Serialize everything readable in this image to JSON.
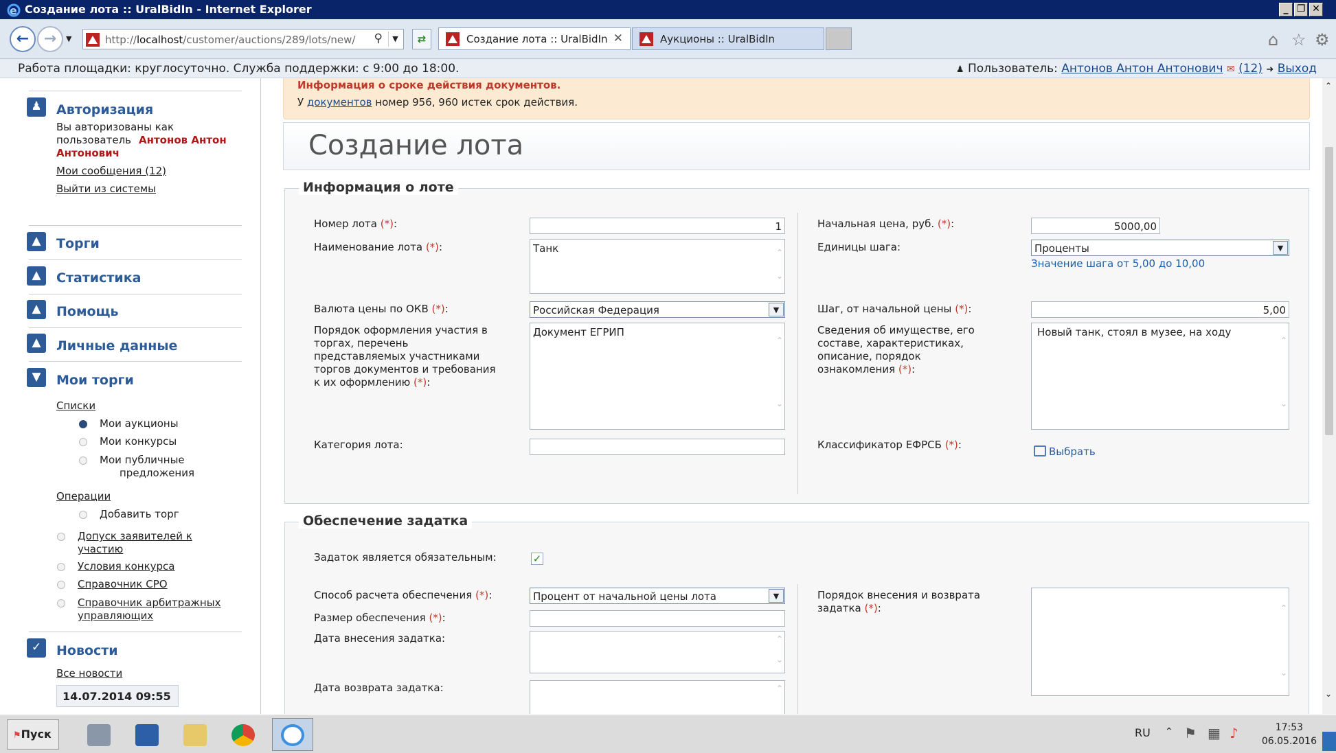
{
  "window": {
    "title": "Создание лота :: UralBidIn - Internet Explorer",
    "controls": [
      "_",
      "❐",
      "✕"
    ]
  },
  "browser": {
    "url_prefix": "http://",
    "url_host": "localhost",
    "url_path": "/customer/auctions/289/lots/new/",
    "tabs": [
      {
        "label": "Создание лота :: UralBidIn",
        "close": "✕"
      },
      {
        "label": "Аукционы :: UralBidIn"
      }
    ]
  },
  "infobar": {
    "left": "Работа площадки: круглосуточно. Служба поддержки: с 9:00 до 18:00.",
    "user_label": "Пользователь:",
    "user_name": "Антонов Антон Антонович",
    "messages": "(12)",
    "logout": "Выход"
  },
  "sidebar": {
    "auth": {
      "title": "Авторизация",
      "text1": "Вы авторизованы как",
      "text2": "пользователь",
      "user": "Антонов Антон",
      "user2": "Антонович",
      "messages": "Мои сообщения (12)",
      "logout": "Выйти из системы"
    },
    "sections": [
      "Торги",
      "Статистика",
      "Помощь",
      "Личные данные",
      "Мои торги"
    ],
    "lists": {
      "title": "Списки",
      "items": [
        "Мои аукционы",
        "Мои конкурсы",
        "Мои публичные",
        "предложения"
      ]
    },
    "operations": {
      "title": "Операции",
      "add": "Добавить торг",
      "links": [
        [
          "Допуск заявителей к",
          "участию"
        ],
        [
          "Условия конкурса"
        ],
        [
          "Справочник СРО"
        ],
        [
          "Справочник арбитражных",
          "управляющих"
        ]
      ]
    },
    "news": {
      "title": "Новости",
      "all": "Все новости",
      "date": "14.07.2014 09:55"
    }
  },
  "warning": {
    "title": "Информация о сроке действия документов.",
    "prefix": "У",
    "link": "документов",
    "suffix": "номер 956, 960 истек срок действия."
  },
  "page_title": "Создание лота",
  "lot_info": {
    "legend": "Информация о лоте",
    "lot_number": {
      "label": "Номер лота",
      "value": "1"
    },
    "lot_name": {
      "label": "Наименование лота",
      "value": "Танк"
    },
    "currency": {
      "label": "Валюта цены по ОКВ",
      "value": "Российская Федерация"
    },
    "order": {
      "label_lines": [
        "Порядок оформления участия в",
        "торгах, перечень",
        "представляемых участниками",
        "торгов документов и требования",
        "к их оформлению"
      ],
      "value": "Документ ЕГРИП"
    },
    "category": {
      "label": "Категория лота:",
      "value": ""
    },
    "start_price": {
      "label": "Начальная цена, руб.",
      "value": "5000,00"
    },
    "step_units": {
      "label": "Единицы шага:",
      "value": "Проценты",
      "hint": "Значение шага от 5,00 до 10,00"
    },
    "step": {
      "label": "Шаг, от начальной цены",
      "value": "5,00"
    },
    "property": {
      "label_lines": [
        "Сведения об имуществе, его",
        "составе, характеристиках,",
        "описание, порядок",
        "ознакомления"
      ],
      "value": "Новый танк, стоял в музее, на ходу"
    },
    "efrsb": {
      "label": "Классификатор ЕФРСБ",
      "button": "Выбрать"
    },
    "req_mark": "(*)"
  },
  "deposit": {
    "legend": "Обеспечение задатка",
    "mandatory": {
      "label": "Задаток является обязательным:",
      "checked": true,
      "mark": "✓"
    },
    "method": {
      "label": "Способ расчета обеспечения",
      "value": "Процент от начальной цены лота"
    },
    "size": {
      "label": "Размер обеспечения",
      "value": ""
    },
    "date_in": {
      "label": "Дата внесения задатка:",
      "value": ""
    },
    "date_out": {
      "label": "Дата возврата задатка:",
      "value": ""
    },
    "order": {
      "label_lines": [
        "Порядок внесения и возврата",
        "задатка"
      ],
      "value": ""
    }
  },
  "taskbar": {
    "start": "Пуск",
    "lang": "RU",
    "time": "17:53",
    "date": "06.05.2016"
  }
}
